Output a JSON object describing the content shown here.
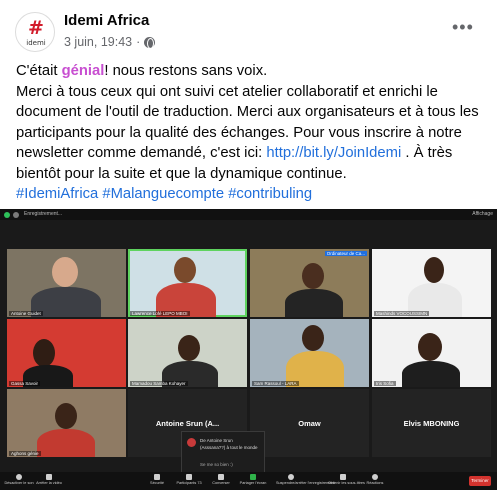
{
  "post": {
    "page_name": "Idemi Africa",
    "date": "3 juin, 19:43",
    "separator": "·",
    "avatar_brand": "idemi",
    "avatar_mark": "#",
    "more_label": "•••",
    "text": {
      "l1_a": "C'était ",
      "l1_highlight": "génial",
      "l1_b": "! nous restons sans voix.",
      "body": "Merci à tous ceux qui ont suivi cet atelier collaboratif et enrichi le document de l'outil de traduction. Merci aux organisateurs et à tous les participants pour la qualité des échanges. Pour vous inscrire à notre newsletter comme demandé, c'est ici: ",
      "link": "http://bit.ly/JoinIdemi",
      "after_link": " . À très bientôt pour la suite et que la dynamique continue.",
      "hashtags": "#IdemiAfrica #Malanguecompte #contribuling"
    }
  },
  "zoom": {
    "top_title": "Enregistrement...",
    "view_label": "Affichage",
    "tiles": [
      {
        "name": "Antoine Guidet"
      },
      {
        "name": "Lawrence Lofé LEPO MBOI"
      },
      {
        "name": "Ordinateur de Ca..."
      },
      {
        "name": "Mashinds VOCOUSSIMN"
      },
      {
        "name": "Gassa Savoir"
      },
      {
        "name": "Mamadou Samba Kohayer"
      },
      {
        "name": "Sam Rassoul - LARA"
      },
      {
        "name": "Iris Sofia"
      },
      {
        "name": "Aghons génie"
      },
      {
        "name": "Antoine Srun (A...",
        "big": true
      },
      {
        "name": "Omaw",
        "big": true
      },
      {
        "name": "Elvis MBONING",
        "big": true
      }
    ],
    "notification": {
      "line1": "De Antoine Srun",
      "line2": "(Asssana??) à tout le monde",
      "line3": "Se me so bien :)"
    },
    "controls": [
      {
        "label": "Désactiver le son"
      },
      {
        "label": "Arrêter la vidéo"
      },
      {
        "label": "Sécurité"
      },
      {
        "label": "Participants  73"
      },
      {
        "label": "Converser"
      },
      {
        "label": "Partager l'écran"
      },
      {
        "label": "Suspendre/arrêter l'enregistrement"
      },
      {
        "label": "Obtenir les sous-titres"
      },
      {
        "label": "Réactions"
      }
    ],
    "end_label": "Terminer"
  }
}
